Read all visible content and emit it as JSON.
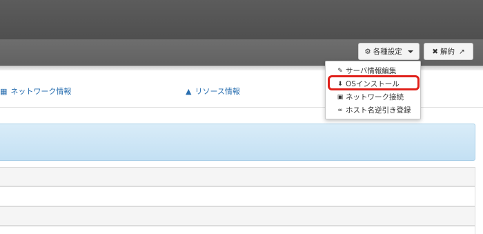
{
  "toolbar": {
    "settings_label": "各種設定",
    "cancel_label": "解約",
    "settings_icon": "gear-icon",
    "cancel_icon": "close-icon",
    "external_icon": "external-link-icon"
  },
  "tabs": [
    {
      "label": "ネットワーク情報",
      "icon": "sitemap-icon"
    },
    {
      "label": "リソース情報",
      "icon": "area-chart-icon"
    }
  ],
  "dropdown": {
    "items": [
      {
        "label": "サーバ情報編集",
        "icon": "pencil-icon"
      },
      {
        "label": "OSインストール",
        "icon": "install-icon",
        "highlighted": true
      },
      {
        "label": "ネットワーク接続",
        "icon": "network-connect-icon"
      },
      {
        "label": "ホスト名逆引き登録",
        "icon": "link-icon"
      }
    ]
  },
  "colors": {
    "highlight_border": "#e0201a",
    "link": "#2a6fb0",
    "info_panel": "#c3e0f3"
  }
}
